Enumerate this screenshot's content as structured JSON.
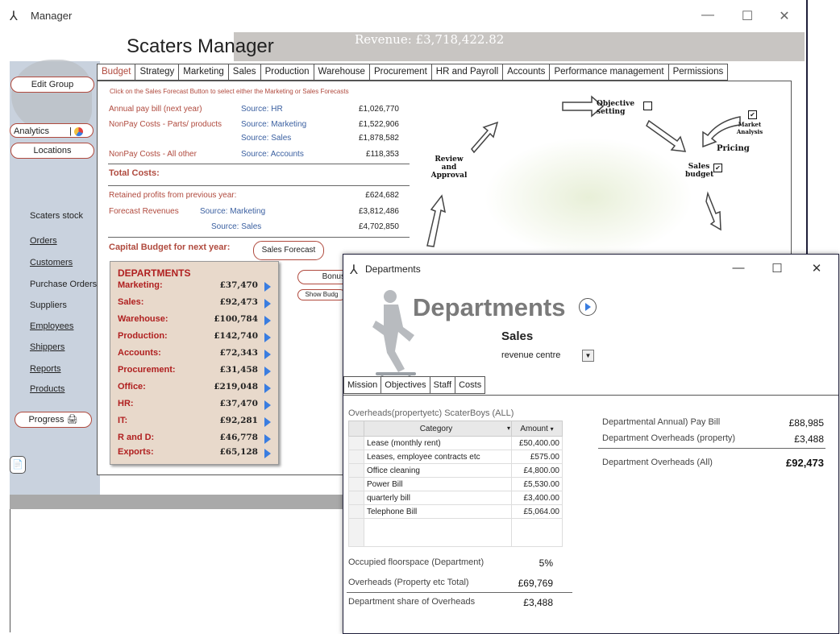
{
  "window": {
    "title": "Manager"
  },
  "app": {
    "title": "Scaters Manager",
    "revenue": "Revenue: £3,718,422.82"
  },
  "sidebar": {
    "edit_group": "Edit Group",
    "analytics": "Analytics",
    "locations": "Locations",
    "items": [
      "Scaters stock",
      "Orders",
      "Customers",
      "Purchase Orders",
      "Suppliers",
      "Employees",
      "Shippers",
      "Reports",
      "Products"
    ],
    "progress": "Progress"
  },
  "tabs": [
    "Budget",
    "Strategy",
    "Marketing",
    "Sales",
    "Production",
    "Warehouse",
    "Procurement",
    "HR and Payroll",
    "Accounts",
    "Performance management",
    "Permissions"
  ],
  "budget": {
    "hint": "Click on the Sales Forecast Button to select either the Marketing or Sales Forecasts",
    "annual_pay_label": "Annual pay bill (next year)",
    "annual_pay_source": "Source: HR",
    "annual_pay_value": "£1,026,770",
    "nonpay_parts_label": "NonPay Costs - Parts/ products",
    "nonpay_parts_source1": "Source: Marketing",
    "nonpay_parts_value1": "£1,522,906",
    "nonpay_parts_source2": "Source: Sales",
    "nonpay_parts_value2": "£1,878,582",
    "nonpay_other_label": "NonPay Costs - All other",
    "nonpay_other_source": "Source: Accounts",
    "nonpay_other_value": "£118,353",
    "total_costs_label": "Total Costs:",
    "retained_label": "Retained profits from previous year:",
    "retained_value": "£624,682",
    "forecast_label": "Forecast Revenues",
    "forecast_source1": "Source: Marketing",
    "forecast_value1": "£3,812,486",
    "forecast_source2": "Source: Sales",
    "forecast_value2": "£4,702,850",
    "capital_label": "Capital Budget for next year:",
    "sales_forecast_btn": "Sales Forecast",
    "bonus_btn": "Bonus",
    "show_budget_btn": "Show Budg"
  },
  "departments_box": {
    "title": "DEPARTMENTS",
    "rows": [
      {
        "name": "Marketing:",
        "value": "£37,470"
      },
      {
        "name": "Sales:",
        "value": "£92,473"
      },
      {
        "name": "Warehouse:",
        "value": "£100,784"
      },
      {
        "name": "Production:",
        "value": "£142,740"
      },
      {
        "name": "Accounts:",
        "value": "£72,343"
      },
      {
        "name": "Procurement:",
        "value": "£31,458"
      },
      {
        "name": "Office:",
        "value": "£219,048"
      },
      {
        "name": "HR:",
        "value": "£37,470"
      },
      {
        "name": "IT:",
        "value": "£92,281"
      },
      {
        "name": "R and D:",
        "value": "£46,778"
      },
      {
        "name": "Exports:",
        "value": "£65,128"
      }
    ]
  },
  "diagram": {
    "objective": "Objective setting",
    "market_analysis": "Market Analysis",
    "pricing": "Pricing",
    "sales_budget": "Sales budget",
    "review": "Review and Approval"
  },
  "dept_window": {
    "title": "Departments",
    "heading": "Departments",
    "dept_name": "Sales",
    "dept_type": "revenue centre",
    "tabs": [
      "Mission",
      "Objectives",
      "Staff",
      "Costs"
    ],
    "grid_caption": "Overheads(propertyetc) ScaterBoys (ALL)",
    "grid_headers": [
      "Category",
      "Amount"
    ],
    "grid_rows": [
      {
        "category": "Lease (monthly rent)",
        "amount": "£50,400.00"
      },
      {
        "category": "Leases, employee contracts etc",
        "amount": "£575.00"
      },
      {
        "category": "Office cleaning",
        "amount": "£4,800.00"
      },
      {
        "category": "Power Bill",
        "amount": "£5,530.00"
      },
      {
        "category": "quarterly bill",
        "amount": "£3,400.00"
      },
      {
        "category": "Telephone Bill",
        "amount": "£5,064.00"
      }
    ],
    "occupied_label": "Occupied floorspace (Department)",
    "occupied_value": "5%",
    "overheads_total_label": "Overheads (Property etc Total)",
    "overheads_total_value": "£69,769",
    "share_label": "Department share of Overheads",
    "share_value": "£3,488",
    "pay_bill_label": "Departmental Annual) Pay Bill",
    "pay_bill_value": "£88,985",
    "overheads_prop_label": "Department Overheads (property)",
    "overheads_prop_value": "£3,488",
    "overheads_all_label": "Department Overheads (All)",
    "overheads_all_value": "£92,473"
  }
}
